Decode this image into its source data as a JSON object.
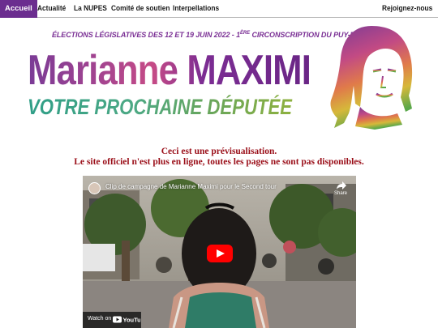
{
  "nav": {
    "items": [
      {
        "label": "Accueil",
        "active": true
      },
      {
        "label": "Actualité",
        "active": false
      },
      {
        "label": "La NUPES",
        "active": false
      },
      {
        "label": "Comité de soutien",
        "active": false
      },
      {
        "label": "Interpellations",
        "active": false
      }
    ],
    "join_label": "Rejoignez-nous",
    "active_color": "#6b2d8f"
  },
  "banner": {
    "subtitle_main": "ÉLECTIONS LÉGISLATIVES DES 12 ET 19 JUIN 2022 - 1",
    "subtitle_sup": "ÈRE",
    "subtitle_end": " CIRCONSCRIPTION DU PUY-DE-DÔME",
    "name": "Marianne MAXIMI",
    "tagline": "VOTRE PROCHAINE DÉPUTÉE"
  },
  "notice": {
    "line1": "Ceci est une prévisualisation.",
    "line2": "Le site officiel n'est plus en ligne, toutes les pages ne sont pas disponibles.",
    "color": "#9a0e18"
  },
  "video": {
    "title": "Clip de campagne de Marianne Maximi pour le Second tour",
    "share_label": "Share",
    "watch_on_label": "Watch on",
    "youtube_label": "YouTube",
    "play_color": "#ff0000"
  }
}
